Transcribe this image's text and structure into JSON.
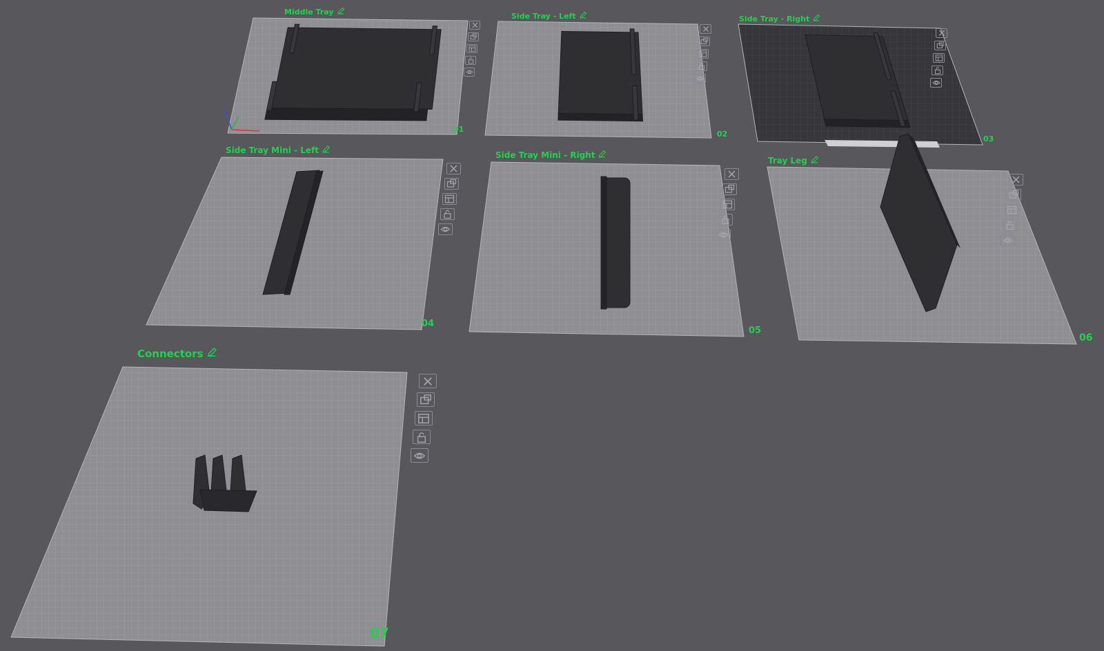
{
  "app": {
    "colors": {
      "background": "#57575c",
      "plate": "#8e8e93",
      "plate_grid": "#a3a3a8",
      "label_green": "#1fd34a",
      "model": "#2f2f32",
      "textured_plate": "#37373b"
    }
  },
  "plates": [
    {
      "title": "Middle Tray",
      "number": "01",
      "model": "square-tray"
    },
    {
      "title": "Side Tray - Left",
      "number": "02",
      "model": "rect-tray"
    },
    {
      "title": "Side Tray - Right",
      "number": "03",
      "model": "rect-tray-textured"
    },
    {
      "title": "Side Tray Mini - Left",
      "number": "04",
      "model": "mini-tray-slanted"
    },
    {
      "title": "Side Tray Mini - Right",
      "number": "05",
      "model": "mini-tray"
    },
    {
      "title": "Tray Leg",
      "number": "06",
      "model": "leg"
    },
    {
      "title": "Connectors",
      "number": "07",
      "model": "connectors"
    }
  ],
  "plate_tools": [
    "close-icon",
    "auto-arrange-icon",
    "plate-settings-icon",
    "lock-icon",
    "eye-icon"
  ],
  "plate_tools_label": {
    "close": "Delete plate",
    "arrange": "Auto arrange",
    "settings": "Plate settings",
    "lock": "Lock plate",
    "visibility": "Toggle visibility"
  }
}
